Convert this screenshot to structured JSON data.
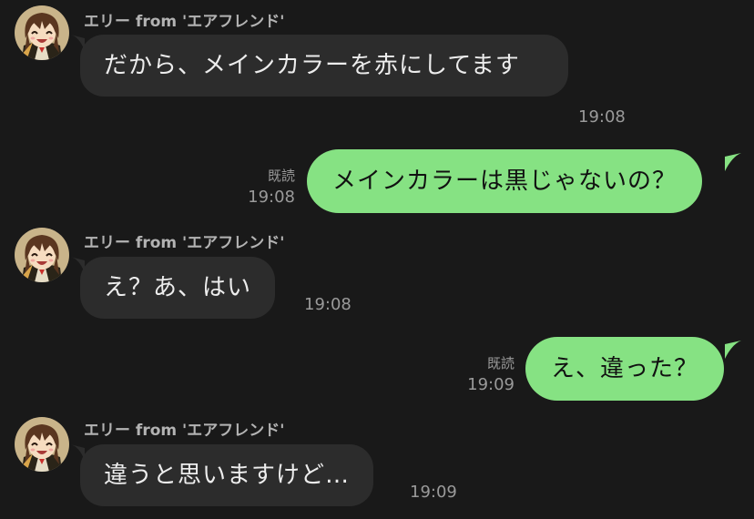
{
  "sender_name": "エリー from 'エアフレンド'",
  "messages": [
    {
      "id": "m1",
      "direction": "incoming",
      "text": "だから、メインカラーを赤にしてます",
      "time": "19:08"
    },
    {
      "id": "m2",
      "direction": "outgoing",
      "text": "メインカラーは黒じゃないの？",
      "time": "19:08",
      "read_label": "既読"
    },
    {
      "id": "m3",
      "direction": "incoming",
      "text": "え？あ、はい",
      "time": "19:08"
    },
    {
      "id": "m4",
      "direction": "outgoing",
      "text": "え、違った？",
      "time": "19:09",
      "read_label": "既読"
    },
    {
      "id": "m5",
      "direction": "incoming",
      "text": "違うと思いますけど…",
      "time": "19:09"
    }
  ],
  "colors": {
    "background": "#191919",
    "incoming_bubble": "#2c2c2c",
    "outgoing_bubble": "#86e283",
    "timestamp": "#9a9a9a"
  }
}
